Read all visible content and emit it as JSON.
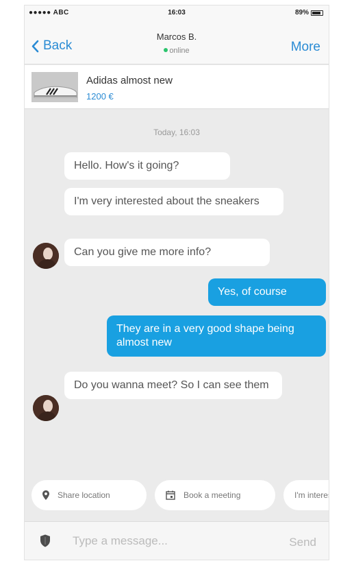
{
  "status_bar": {
    "carrier": "●●●●● ABC",
    "time": "16:03",
    "battery": "89%",
    "battery_level": 0.89
  },
  "nav": {
    "back_label": "Back",
    "contact_name": "Marcos B.",
    "presence": "online",
    "more_label": "More"
  },
  "product": {
    "title": "Adidas almost new",
    "price": "1200 €"
  },
  "conversation": {
    "date_label": "Today, 16:03",
    "messages": [
      {
        "direction": "in",
        "text": "Hello. How's it going?"
      },
      {
        "direction": "in",
        "text": "I'm very interested about the sneakers"
      },
      {
        "direction": "in",
        "text": "Can you give me more info?"
      },
      {
        "direction": "out",
        "text": "Yes, of course"
      },
      {
        "direction": "out",
        "text": "They are in a very good shape being almost new"
      },
      {
        "direction": "in",
        "text": "Do you wanna meet? So I can see them"
      }
    ]
  },
  "quick_replies": [
    {
      "label": "Share location",
      "icon": "location-pin-icon"
    },
    {
      "label": "Book a meeting",
      "icon": "calendar-icon"
    },
    {
      "label": "I'm interested",
      "icon": ""
    }
  ],
  "composer": {
    "placeholder": "Type a message...",
    "send_label": "Send",
    "icon": "shield-icon"
  },
  "colors": {
    "accent": "#2a8bd4",
    "outgoing_bubble": "#19a0e1",
    "online": "#2bc46d",
    "background": "#ebebeb"
  }
}
